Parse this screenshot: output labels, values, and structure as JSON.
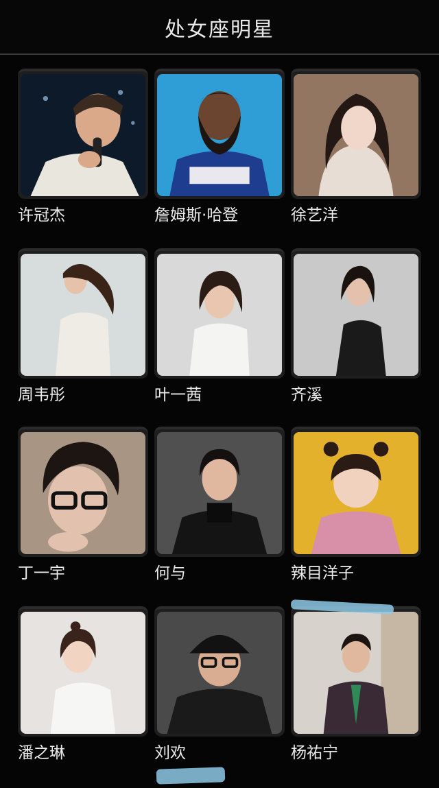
{
  "header": {
    "title": "处女座明星"
  },
  "celebrities": [
    {
      "name": "许冠杰",
      "photo_desc": "man-with-microphone-portrait"
    },
    {
      "name": "詹姆斯·哈登",
      "photo_desc": "bearded-basketball-player-portrait"
    },
    {
      "name": "徐艺洋",
      "photo_desc": "young-woman-portrait"
    },
    {
      "name": "周韦彤",
      "photo_desc": "woman-in-lace-dress-portrait"
    },
    {
      "name": "叶一茜",
      "photo_desc": "woman-in-white-top-portrait"
    },
    {
      "name": "齐溪",
      "photo_desc": "woman-in-black-dress-portrait"
    },
    {
      "name": "丁一宇",
      "photo_desc": "man-with-glasses-portrait"
    },
    {
      "name": "何与",
      "photo_desc": "man-in-black-turtleneck-portrait"
    },
    {
      "name": "辣目洋子",
      "photo_desc": "woman-with-buns-on-yellow-portrait"
    },
    {
      "name": "潘之琳",
      "photo_desc": "woman-in-white-tee-portrait"
    },
    {
      "name": "刘欢",
      "photo_desc": "man-with-cap-and-glasses-portrait"
    },
    {
      "name": "杨祐宁",
      "photo_desc": "man-in-plaid-suit-portrait"
    }
  ]
}
